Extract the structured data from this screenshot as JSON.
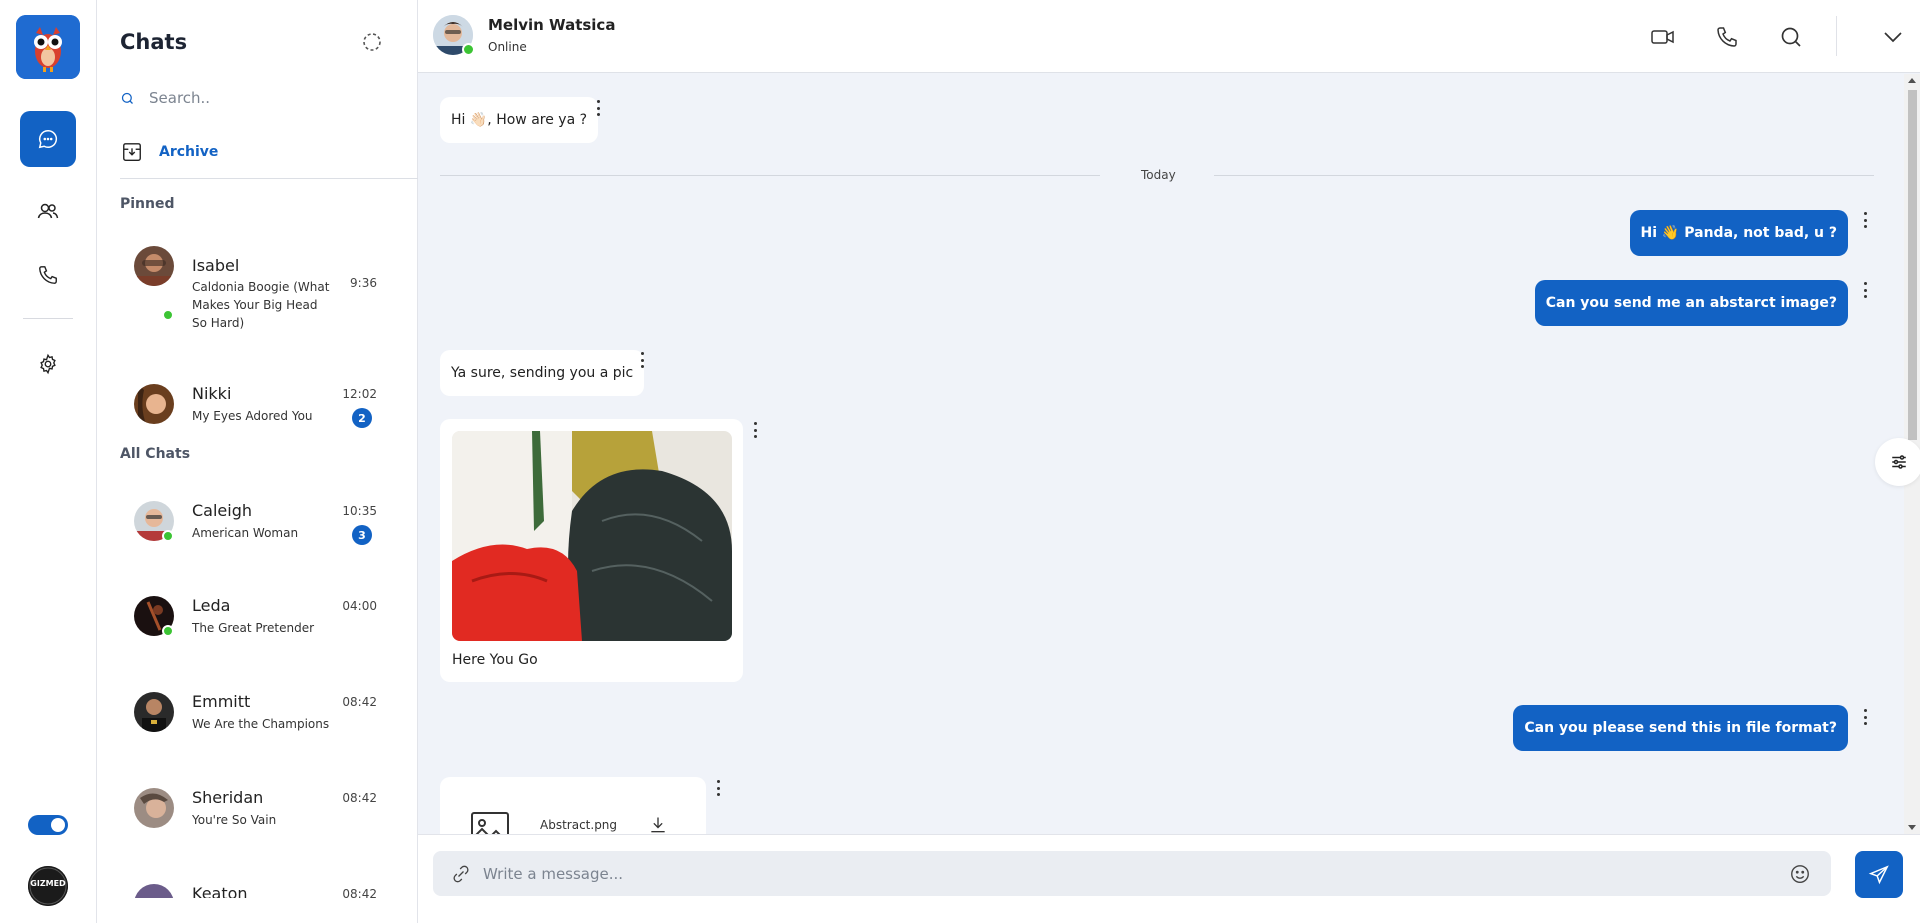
{
  "colors": {
    "accent": "#1262c4",
    "online": "#3cc434",
    "conversation_bg": "#f0f3f9"
  },
  "rail": {
    "icons": [
      "chat-bubble-icon",
      "users-icon",
      "phone-icon",
      "gear-icon"
    ],
    "theme_toggle_on": true,
    "avatar_text": "GIZMED"
  },
  "panel": {
    "title": "Chats",
    "search_placeholder": "Search..",
    "archive_label": "Archive",
    "pinned_label": "Pinned",
    "all_chats_label": "All Chats",
    "pinned": [
      {
        "name": "Isabel",
        "message": "Caldonia Boogie (What Makes Your Big Head So Hard)",
        "time": "9:36",
        "online": true,
        "unread": ""
      },
      {
        "name": "Nikki",
        "message": "My Eyes Adored You",
        "time": "12:02",
        "online": false,
        "unread": "2"
      }
    ],
    "all": [
      {
        "name": "Caleigh",
        "message": "American Woman",
        "time": "10:35",
        "online": true,
        "unread": "3"
      },
      {
        "name": "Leda",
        "message": "The Great Pretender",
        "time": "04:00",
        "online": true,
        "unread": ""
      },
      {
        "name": "Emmitt",
        "message": "We Are the Champions",
        "time": "08:42",
        "online": false,
        "unread": ""
      },
      {
        "name": "Sheridan",
        "message": "You're So Vain",
        "time": "08:42",
        "online": false,
        "unread": ""
      },
      {
        "name": "Keaton",
        "message": "",
        "time": "08:42",
        "online": false,
        "unread": ""
      }
    ]
  },
  "conversation": {
    "contact_name": "Melvin Watsica",
    "contact_status": "Online",
    "header_icons": [
      "video-icon",
      "phone-icon",
      "search-icon",
      "chevron-down-icon"
    ],
    "date_divider": "Today",
    "messages": [
      {
        "dir": "in",
        "text": "Hi 👋🏻, How are ya ?"
      },
      {
        "dir": "out",
        "text": "Hi 👋 Panda, not bad, u ?"
      },
      {
        "dir": "out",
        "text": "Can you send me an abstarct image?"
      },
      {
        "dir": "in",
        "text": "Ya sure, sending you a pic"
      },
      {
        "dir": "in",
        "type": "image",
        "caption": "Here You Go"
      },
      {
        "dir": "out",
        "text": "Can you please send this in file format?"
      },
      {
        "dir": "in",
        "type": "file",
        "file_name": "Abstract.png"
      }
    ],
    "composer_placeholder": "Write a message..."
  }
}
